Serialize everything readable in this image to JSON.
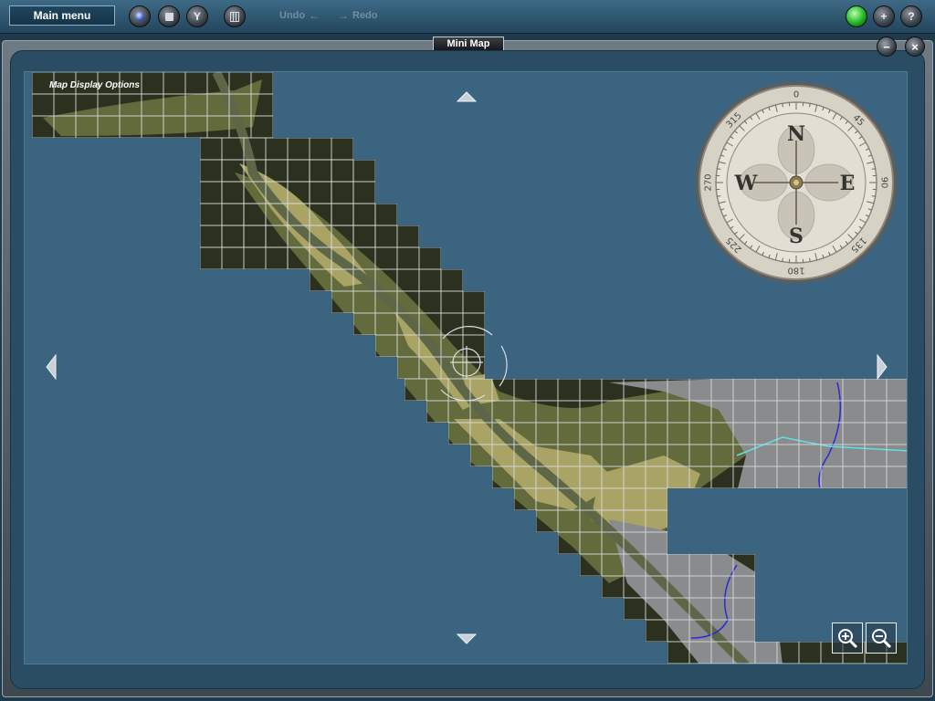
{
  "toolbar": {
    "main_menu_label": "Main menu",
    "undo_label": "Undo",
    "redo_label": "Redo",
    "icons": [
      "globe-icon",
      "stop-icon",
      "filter-icon",
      "grid-icon",
      "status-light-icon",
      "add-icon",
      "help-icon"
    ],
    "help_glyph": "?",
    "add_glyph": "+",
    "filter_glyph": "Y"
  },
  "window": {
    "title": "Mini Map",
    "minimize_glyph": "−",
    "close_glyph": "×"
  },
  "map": {
    "options_label": "Map Display Options",
    "compass": {
      "letters": {
        "n": "N",
        "e": "E",
        "s": "S",
        "w": "W"
      },
      "degrees": [
        "0",
        "45",
        "90",
        "135",
        "180",
        "225",
        "270",
        "315"
      ]
    },
    "colors": {
      "water": "#3b6480",
      "dark_terrain": "#2c311f",
      "olive_terrain": "#636b3c",
      "light_terrain": "#a9a466",
      "urban": "#8a8b8c",
      "grid": "#d7dadb"
    }
  }
}
